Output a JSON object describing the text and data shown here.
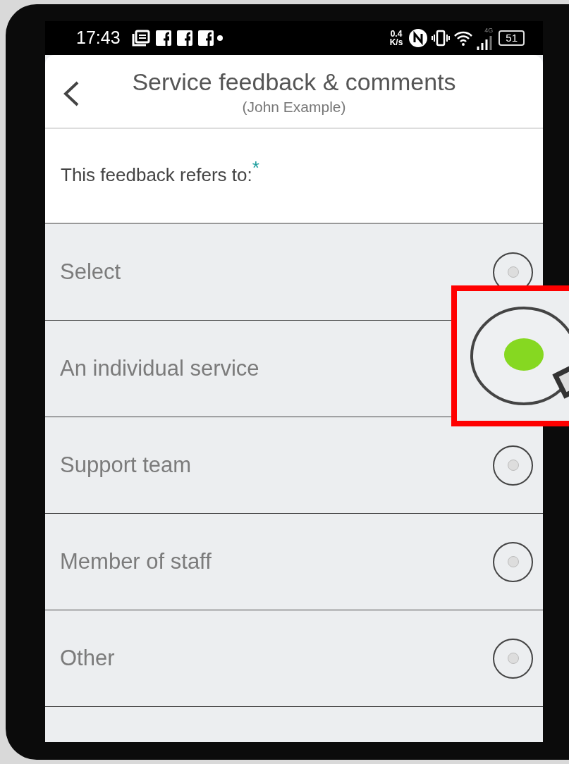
{
  "status_bar": {
    "time": "17:43",
    "speed_value": "0.4",
    "speed_unit": "K/s",
    "network": "4G",
    "battery": "51"
  },
  "header": {
    "title": "Service feedback & comments",
    "subtitle": "(John Example)"
  },
  "question": {
    "label": "This feedback refers to:",
    "required_mark": "*"
  },
  "options": [
    {
      "label": "Select",
      "selected": false
    },
    {
      "label": "An individual service",
      "selected": true
    },
    {
      "label": "Support team",
      "selected": false
    },
    {
      "label": "Member of staff",
      "selected": false
    },
    {
      "label": "Other",
      "selected": false
    }
  ]
}
